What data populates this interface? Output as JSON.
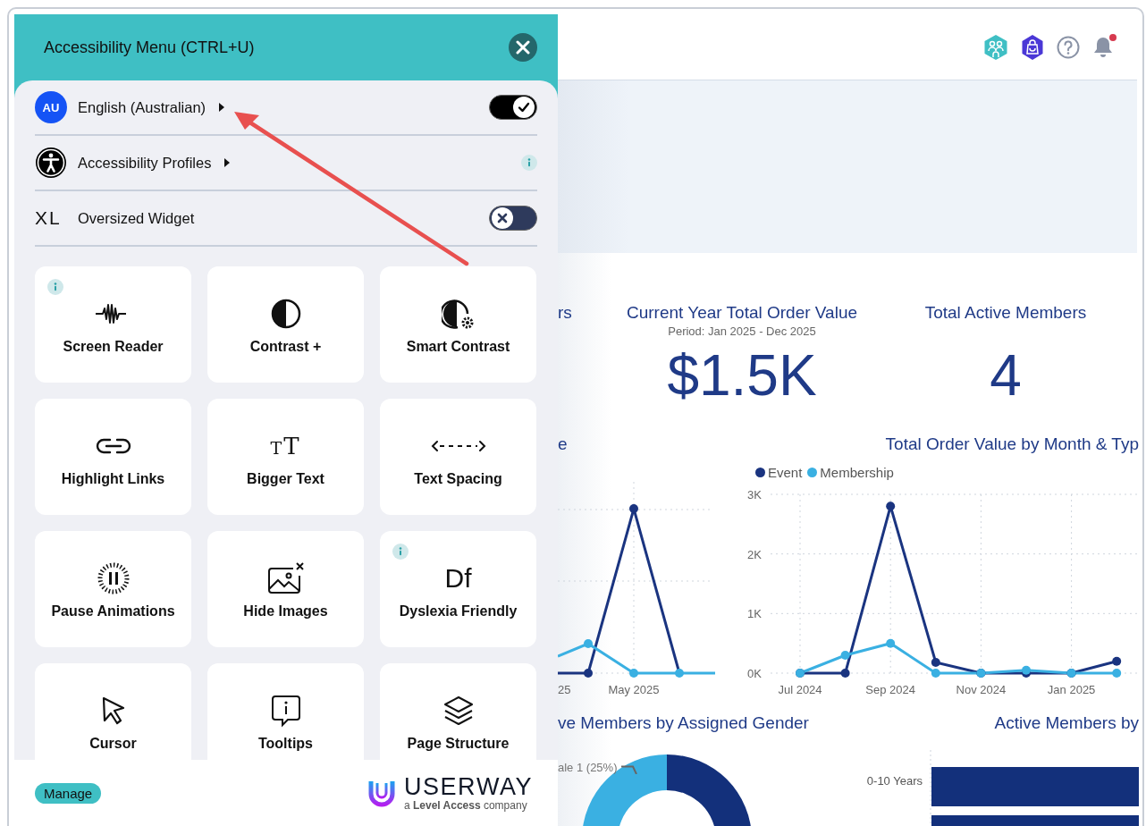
{
  "panel": {
    "title": "Accessibility Menu (CTRL+U)",
    "rows": [
      {
        "kind": "language",
        "badge": "AU",
        "label": "English (Australian)",
        "submenu": true,
        "info": false,
        "toggle": {
          "on": true
        }
      },
      {
        "kind": "profiles",
        "label": "Accessibility Profiles",
        "submenu": true,
        "info": true
      },
      {
        "kind": "widget",
        "badge": "XL",
        "label": "Oversized Widget",
        "submenu": false,
        "info": false,
        "toggle": {
          "on": false
        }
      }
    ],
    "features": [
      {
        "label": "Screen Reader",
        "info": true
      },
      {
        "label": "Contrast +",
        "info": false
      },
      {
        "label": "Smart Contrast",
        "info": false
      },
      {
        "label": "Highlight Links",
        "info": false
      },
      {
        "label": "Bigger Text",
        "info": false,
        "icon_text": "TT"
      },
      {
        "label": "Text Spacing",
        "info": false
      },
      {
        "label": "Pause Animations",
        "info": false
      },
      {
        "label": "Hide Images",
        "info": false
      },
      {
        "label": "Dyslexia Friendly",
        "info": true,
        "icon_text": "Df"
      },
      {
        "label": "Cursor",
        "info": false
      },
      {
        "label": "Tooltips",
        "info": false
      },
      {
        "label": "Page Structure",
        "info": false
      }
    ],
    "footer": {
      "manage": "Manage",
      "brand": "**USER**WAY",
      "tagline": "a **Level Access** company"
    }
  },
  "dashboard": {
    "header": {
      "notifications_unread": true
    },
    "kpis": [
      {
        "title": "rs"
      },
      {
        "title": "Current Year Total Order Value",
        "period": "Period: Jan 2025 - Dec 2025",
        "value": "$1.5K"
      },
      {
        "title": "Total Active Members",
        "value": "4"
      }
    ],
    "charts": [
      {
        "title": "e",
        "x_labels": [
          "25",
          "May 2025"
        ]
      },
      {
        "title": "Total Order Value by Month & Typ",
        "chart_data": {
          "type": "line",
          "grid": true,
          "categories": [
            "Jul 2024",
            null,
            "Sep 2024",
            null,
            "Nov 2024",
            null,
            "Jan 2025",
            null
          ],
          "series": [
            {
              "name": "Event",
              "color": "#1a3480",
              "marker": true,
              "values": [
                0,
                0,
                2800,
                180,
                0,
                0,
                0,
                200
              ]
            },
            {
              "name": "Membership",
              "color": "#3ab0e2",
              "marker": true,
              "values": [
                0,
                300,
                500,
                0,
                0,
                50,
                0,
                0
              ]
            }
          ],
          "ylim": [
            0,
            3000
          ],
          "yticks": [
            {
              "value": 0,
              "label": "0K"
            },
            {
              "value": 1000,
              "label": "1K"
            },
            {
              "value": 2000,
              "label": "2K"
            },
            {
              "value": 3000,
              "label": "3K"
            }
          ]
        }
      }
    ],
    "bottom": [
      {
        "title": "ve Members by Assigned Gender",
        "slice_label": "ale 1 (25%)"
      },
      {
        "title": "Active Members by",
        "bar_labels": [
          "0-10 Years"
        ]
      }
    ]
  }
}
